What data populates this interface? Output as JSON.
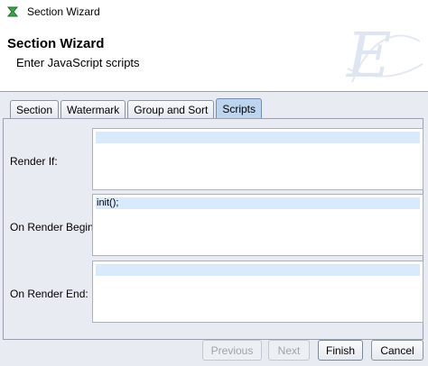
{
  "window": {
    "title": "Section Wizard",
    "icon": "app-icon"
  },
  "header": {
    "title": "Section Wizard",
    "subtitle": "Enter JavaScript scripts",
    "logo_letter": "E"
  },
  "tabs": [
    {
      "label": "Section",
      "active": false
    },
    {
      "label": "Watermark",
      "active": false
    },
    {
      "label": "Group and Sort",
      "active": false
    },
    {
      "label": "Scripts",
      "active": true
    }
  ],
  "fields": [
    {
      "label": "Render If:",
      "value": ""
    },
    {
      "label": "On Render Begin:",
      "value": "init();"
    },
    {
      "label": "On Render End:",
      "value": ""
    }
  ],
  "buttons": {
    "previous": {
      "label": "Previous",
      "enabled": false
    },
    "next": {
      "label": "Next",
      "enabled": false
    },
    "finish": {
      "label": "Finish",
      "enabled": true
    },
    "cancel": {
      "label": "Cancel",
      "enabled": true
    }
  },
  "colors": {
    "body_background": "#e8ecf2",
    "active_tab": "#bcd4ee",
    "script_line_highlight": "#d8eafb"
  }
}
